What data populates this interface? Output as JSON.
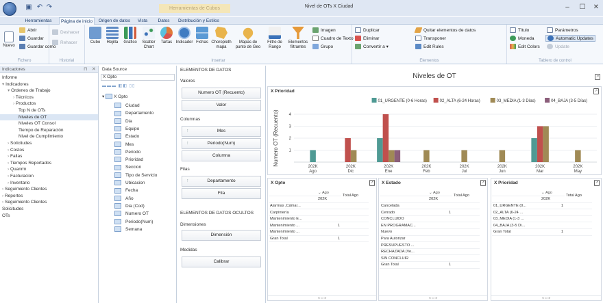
{
  "window": {
    "title": "Nivel de OTs X Ciudad",
    "context_tab": "Herramientas de Cubos",
    "controls": [
      "–",
      "☐",
      "✕"
    ]
  },
  "ribbon_tabs": [
    "Herramientas",
    "Página de inicio",
    "Origen de datos",
    "Vista",
    "Datos",
    "Distribución y Estilos"
  ],
  "ribbon": {
    "fichero": {
      "label": "Fichero",
      "nuevo": "Nuevo",
      "abrir": "Abrir",
      "guardar": "Guardar",
      "guardar_como": "Guardar como"
    },
    "historial": {
      "label": "Historial",
      "deshacer": "Deshacer",
      "rehacer": "Rehacer"
    },
    "insertar": {
      "label": "Insertar",
      "items": [
        "Cubo",
        "Rejilla",
        "Gráfico",
        "Scatter Chart",
        "Tartas",
        "Indicador",
        "Fichas",
        "Choropleth mapa",
        "Mapas de punto de Geo",
        "Filtro de Rango",
        "Elementos filtrantes"
      ]
    },
    "insertar_small": [
      "Imagen",
      "Cuadro de Texto",
      "Grupo"
    ],
    "elementos": {
      "label": "Elementos",
      "items": [
        "Duplicar",
        "Eliminar",
        "Convertir a",
        "Quitar elementos de datos",
        "Transponer",
        "Edit Rules"
      ]
    },
    "tablero": {
      "label": "Tablero de control",
      "items": [
        "Título",
        "Moneda",
        "Edit Colors",
        "Parámetros",
        "Automatic Updates",
        "Update"
      ]
    }
  },
  "left_panel": {
    "header": "Indicadores",
    "tree": [
      "Informe",
      "Indicadores",
      "Ordenes de Trabajo",
      "Técnicos",
      "Productos",
      "Top N de OTs",
      "Niveles de OT",
      "Niveles OT Consol",
      "Tiempo de Reparación",
      "Nivel de Cumplimiento",
      "Solicitudes",
      "Costos",
      "Fallas",
      "Tiempos Reportados",
      "Quanrm",
      "Facturacion",
      "Inventario",
      "Seguimiento Clientes",
      "Reportes",
      "Seguimiento Clientes",
      "Solicitudes",
      "OTs"
    ]
  },
  "data_source": {
    "header": "Data Source",
    "source": "X Opto",
    "root": "X Opto",
    "fields": [
      "Ciudad",
      "Departamento",
      "Dia",
      "Equipo",
      "Estado",
      "Mes",
      "Periodo",
      "Prioridad",
      "Seccion",
      "Tipo de Servicio",
      "Ubicacion",
      "Fecha",
      "Año",
      "Dia (Cod)",
      "Numero OT",
      "Periodo(Num)",
      "Semana"
    ]
  },
  "bindings": {
    "header": "ELEMENTOS DE DATOS",
    "valores": "Valores",
    "valor1": "Numero OT (Recuento)",
    "valor2": "Valor",
    "columnas": "Columnas",
    "col1": "Mes",
    "col2": "Periodo(Num)",
    "col3": "Columna",
    "filas": "Filas",
    "fila1": "Departamento",
    "fila2": "Fila",
    "ocultos": "ELEMENTOS DE DATOS OCULTOS",
    "dimensiones": "Dimensiones",
    "dim1": "Dimensión",
    "medidas": "Medidas",
    "med1": "Calibrar"
  },
  "dashboard": {
    "title": "Niveles de OT",
    "chart_title": "X Prioridad",
    "pivot1": {
      "title": "X Opto",
      "col_header": "Ago",
      "col_sub": "202K",
      "total_header": "Total Ago",
      "rows": [
        {
          "label": "Alarmas ,Cámar...",
          "value": ""
        },
        {
          "label": "Carpintería",
          "value": ""
        },
        {
          "label": "Mantenimiento E...",
          "value": ""
        },
        {
          "label": "Mantenimiento ...",
          "value": "1"
        },
        {
          "label": "Mantenimiento ...",
          "value": ""
        },
        {
          "label": "Gran Total",
          "value": "1"
        }
      ]
    },
    "pivot2": {
      "title": "X Estado",
      "col_header": "Ago",
      "col_sub": "202K",
      "total_header": "Total Ago",
      "rows": [
        {
          "label": "Cancelada",
          "value": ""
        },
        {
          "label": "Cerrado",
          "value": "1"
        },
        {
          "label": "CONCLUIDO",
          "value": ""
        },
        {
          "label": "EN PROGRAMAC...",
          "value": ""
        },
        {
          "label": "Nuevo",
          "value": ""
        },
        {
          "label": "Para Autorizar",
          "value": ""
        },
        {
          "label": "PRESUPUESTO ...",
          "value": ""
        },
        {
          "label": "RECHAZADA (Ve...",
          "value": ""
        },
        {
          "label": "SIN CONCLUIR",
          "value": ""
        },
        {
          "label": "Gran Total",
          "value": "1"
        }
      ]
    },
    "pivot3": {
      "title": "X Prioridad",
      "col_header": "Ago",
      "col_sub": "202K",
      "total_header": "Total Ago",
      "rows": [
        {
          "label": "01_URGENTE (0...",
          "value": "1"
        },
        {
          "label": "02_ALTA (6-24 ...",
          "value": ""
        },
        {
          "label": "03_MEDIA (1-3 ...",
          "value": ""
        },
        {
          "label": "04_BAJA (3-5 Di...",
          "value": ""
        },
        {
          "label": "Gran Total",
          "value": "1"
        }
      ]
    }
  },
  "chart_data": {
    "type": "bar",
    "ylabel": "Numero OT (Recuento)",
    "ylim": [
      0,
      4
    ],
    "yticks": [
      1,
      2,
      3,
      4
    ],
    "grid": true,
    "legend_position": "top-right",
    "categories": [
      {
        "top": "202K",
        "bottom": "Ago"
      },
      {
        "top": "202K",
        "bottom": "Dic"
      },
      {
        "top": "202K",
        "bottom": "Ene"
      },
      {
        "top": "202K",
        "bottom": "Feb"
      },
      {
        "top": "202K",
        "bottom": "Jul"
      },
      {
        "top": "202K",
        "bottom": "Jun"
      },
      {
        "top": "202K",
        "bottom": "Mar"
      },
      {
        "top": "202K",
        "bottom": "May"
      }
    ],
    "series": [
      {
        "name": "01_URGENTE (0-6 Horas)",
        "color": "#4f9a94",
        "values": [
          1,
          0,
          2,
          0,
          0,
          0,
          2,
          0
        ]
      },
      {
        "name": "02_ALTA (6-24 Horas)",
        "color": "#c0504d",
        "values": [
          0,
          2,
          4,
          0,
          0,
          0,
          3,
          0
        ]
      },
      {
        "name": "03_MEDIA (1-3 Días)",
        "color": "#a08a55",
        "values": [
          0,
          1,
          1,
          1,
          1,
          1,
          3,
          1
        ]
      },
      {
        "name": "04_BAJA (3-5 Días)",
        "color": "#8b5e7a",
        "values": [
          0,
          0,
          1,
          0,
          0,
          0,
          0,
          0
        ]
      }
    ]
  }
}
